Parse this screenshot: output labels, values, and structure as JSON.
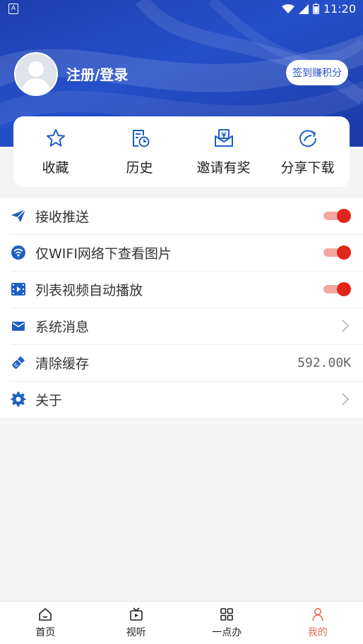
{
  "status_bar": {
    "time": "11:20"
  },
  "profile": {
    "login_text": "注册/登录",
    "checkin_label": "签到赚积分"
  },
  "quick_actions": [
    {
      "label": "收藏",
      "icon": "star-icon"
    },
    {
      "label": "历史",
      "icon": "history-icon"
    },
    {
      "label": "邀请有奖",
      "icon": "gift-icon"
    },
    {
      "label": "分享下载",
      "icon": "share-icon"
    }
  ],
  "settings": {
    "push": {
      "label": "接收推送",
      "enabled": true
    },
    "wifi_images": {
      "label": "仅WIFI网络下查看图片",
      "enabled": true
    },
    "autoplay": {
      "label": "列表视频自动播放",
      "enabled": true
    },
    "messages": {
      "label": "系统消息"
    },
    "clear_cache": {
      "label": "清除缓存",
      "value": "592.00K"
    },
    "about": {
      "label": "关于"
    }
  },
  "bottom_nav": [
    {
      "label": "首页",
      "icon": "home-icon"
    },
    {
      "label": "视听",
      "icon": "video-icon"
    },
    {
      "label": "一点办",
      "icon": "grid-icon"
    },
    {
      "label": "我的",
      "icon": "user-icon",
      "active": true
    }
  ],
  "colors": {
    "header_blue": "#2550c9",
    "accent_blue": "#1e5fc4",
    "toggle_on": "#e0261c",
    "active_tab": "#e46a5a"
  }
}
